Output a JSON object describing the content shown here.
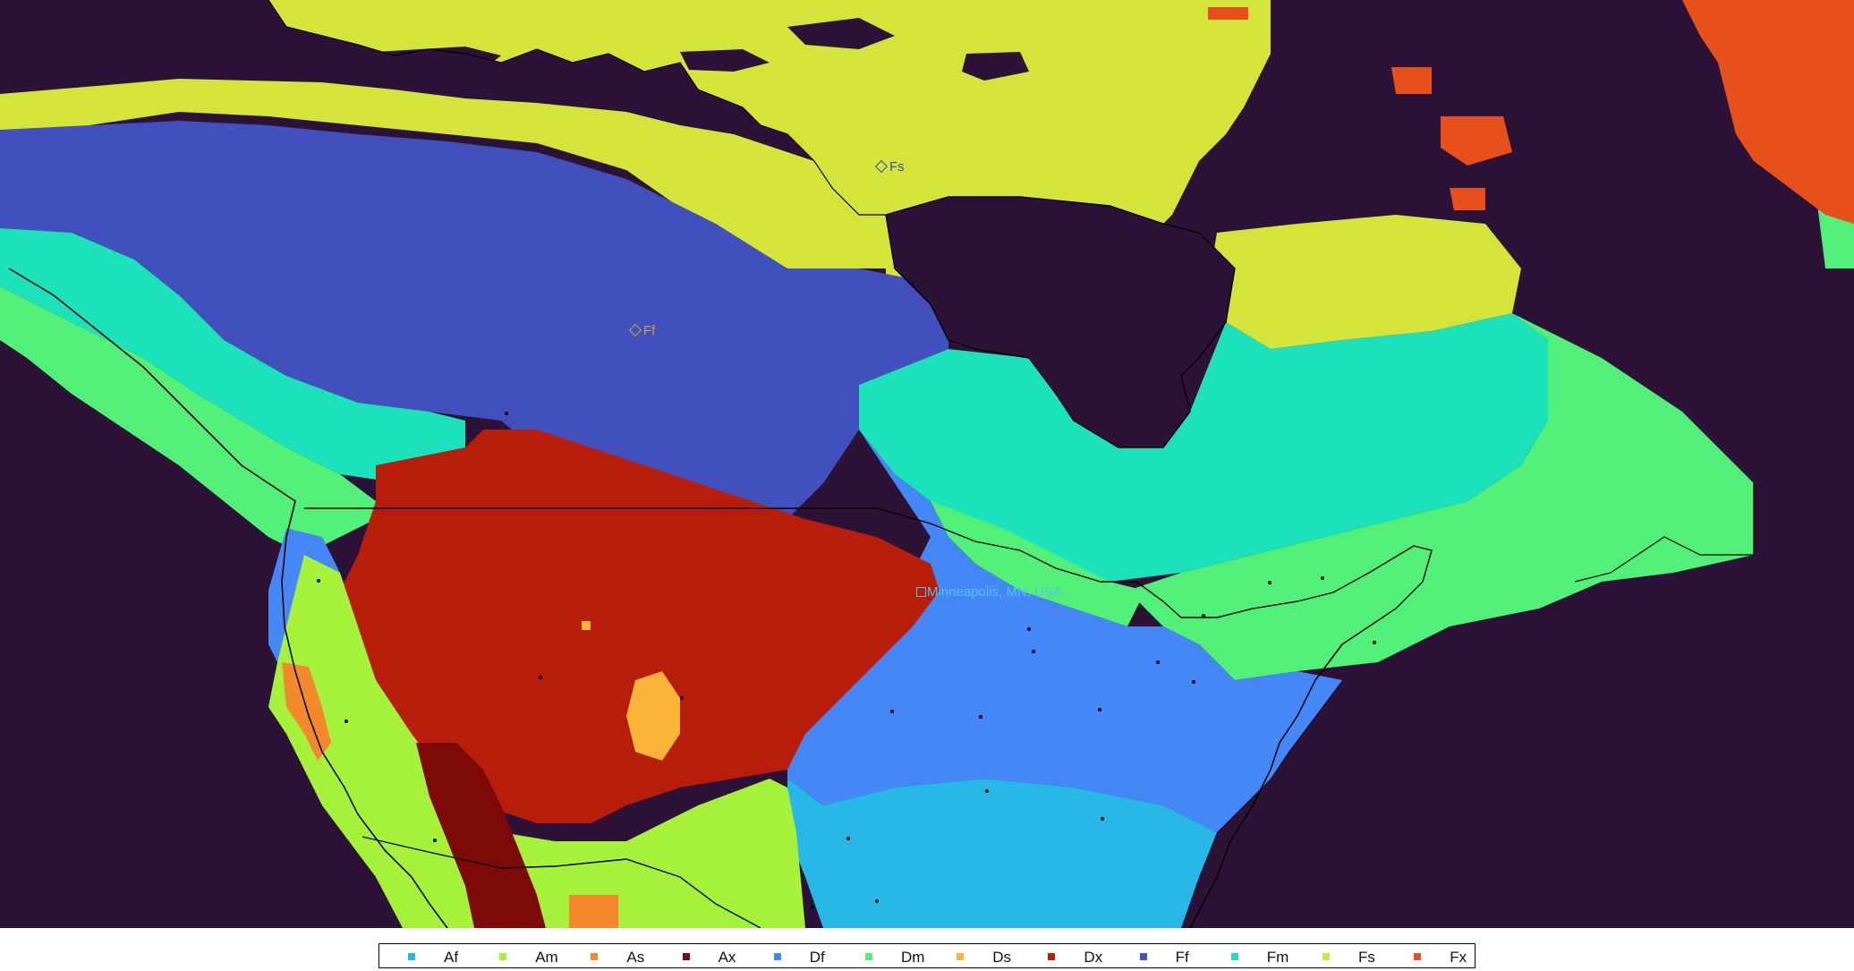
{
  "map": {
    "background_color": "#2d1238",
    "border_line_color": "#000000",
    "classes": [
      {
        "code": "Af",
        "color": "#27b8e8"
      },
      {
        "code": "Am",
        "color": "#a6f23a"
      },
      {
        "code": "As",
        "color": "#f4892c"
      },
      {
        "code": "Ax",
        "color": "#7d0a06"
      },
      {
        "code": "Df",
        "color": "#4587f7"
      },
      {
        "code": "Dm",
        "color": "#52f078"
      },
      {
        "code": "Ds",
        "color": "#fbb43a"
      },
      {
        "code": "Dx",
        "color": "#b81c0a"
      },
      {
        "code": "Ff",
        "color": "#4250bd"
      },
      {
        "code": "Fm",
        "color": "#1be2bb"
      },
      {
        "code": "Fs",
        "color": "#d4e43a"
      },
      {
        "code": "Fx",
        "color": "#e8501b"
      }
    ]
  },
  "markers": {
    "city": {
      "label": "Minneapolis, MN, USA",
      "color": "#4fc4ec",
      "icon": "square-marker-icon"
    },
    "region_fs": {
      "label": "Fs",
      "color": "#3a48b8",
      "icon": "diamond-marker-icon"
    },
    "region_ff": {
      "label": "Ff",
      "color": "#c8a23a",
      "icon": "diamond-marker-icon"
    }
  }
}
